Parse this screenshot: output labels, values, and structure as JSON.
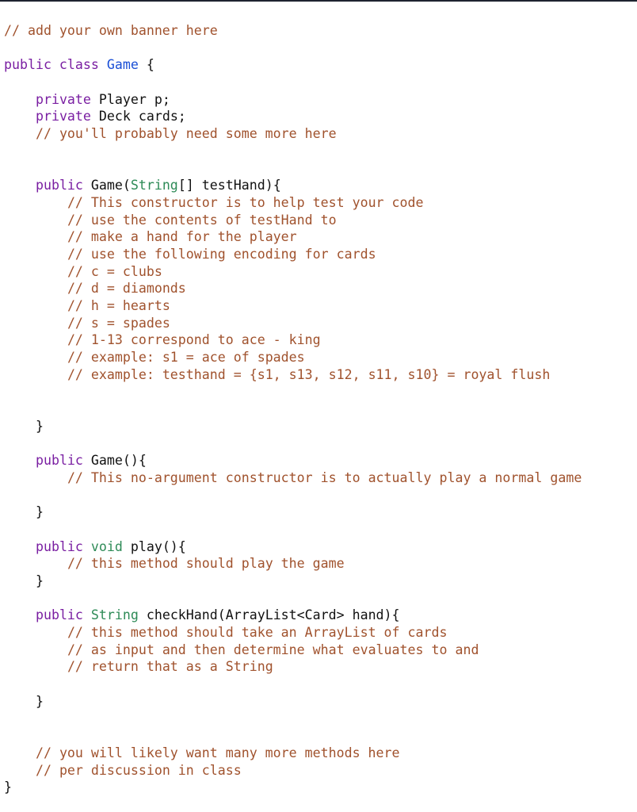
{
  "editor": {
    "lines": [
      [
        {
          "t": "cm",
          "v": "// add your own banner here"
        }
      ],
      [],
      [
        {
          "t": "kw",
          "v": "public class "
        },
        {
          "t": "cls",
          "v": "Game"
        },
        {
          "t": "pl",
          "v": " {"
        }
      ],
      [],
      [
        {
          "t": "pl",
          "v": "    "
        },
        {
          "t": "kw",
          "v": "private "
        },
        {
          "t": "pl",
          "v": "Player p;"
        }
      ],
      [
        {
          "t": "pl",
          "v": "    "
        },
        {
          "t": "kw",
          "v": "private "
        },
        {
          "t": "pl",
          "v": "Deck cards;"
        }
      ],
      [
        {
          "t": "pl",
          "v": "    "
        },
        {
          "t": "cm",
          "v": "// you'll probably need some more here"
        }
      ],
      [],
      [],
      [
        {
          "t": "pl",
          "v": "    "
        },
        {
          "t": "kw",
          "v": "public "
        },
        {
          "t": "pl",
          "v": "Game("
        },
        {
          "t": "ty",
          "v": "String"
        },
        {
          "t": "pl",
          "v": "[] testHand){"
        }
      ],
      [
        {
          "t": "pl",
          "v": "        "
        },
        {
          "t": "cm",
          "v": "// This constructor is to help test your code"
        }
      ],
      [
        {
          "t": "pl",
          "v": "        "
        },
        {
          "t": "cm",
          "v": "// use the contents of testHand to"
        }
      ],
      [
        {
          "t": "pl",
          "v": "        "
        },
        {
          "t": "cm",
          "v": "// make a hand for the player"
        }
      ],
      [
        {
          "t": "pl",
          "v": "        "
        },
        {
          "t": "cm",
          "v": "// use the following encoding for cards"
        }
      ],
      [
        {
          "t": "pl",
          "v": "        "
        },
        {
          "t": "cm",
          "v": "// c = clubs"
        }
      ],
      [
        {
          "t": "pl",
          "v": "        "
        },
        {
          "t": "cm",
          "v": "// d = diamonds"
        }
      ],
      [
        {
          "t": "pl",
          "v": "        "
        },
        {
          "t": "cm",
          "v": "// h = hearts"
        }
      ],
      [
        {
          "t": "pl",
          "v": "        "
        },
        {
          "t": "cm",
          "v": "// s = spades"
        }
      ],
      [
        {
          "t": "pl",
          "v": "        "
        },
        {
          "t": "cm",
          "v": "// 1-13 correspond to ace - king"
        }
      ],
      [
        {
          "t": "pl",
          "v": "        "
        },
        {
          "t": "cm",
          "v": "// example: s1 = ace of spades"
        }
      ],
      [
        {
          "t": "pl",
          "v": "        "
        },
        {
          "t": "cm",
          "v": "// example: testhand = {s1, s13, s12, s11, s10} = royal flush"
        }
      ],
      [],
      [],
      [
        {
          "t": "pl",
          "v": "    }"
        }
      ],
      [],
      [
        {
          "t": "pl",
          "v": "    "
        },
        {
          "t": "kw",
          "v": "public "
        },
        {
          "t": "pl",
          "v": "Game(){"
        }
      ],
      [
        {
          "t": "pl",
          "v": "        "
        },
        {
          "t": "cm",
          "v": "// This no-argument constructor is to actually play a normal game"
        }
      ],
      [],
      [
        {
          "t": "pl",
          "v": "    }"
        }
      ],
      [],
      [
        {
          "t": "pl",
          "v": "    "
        },
        {
          "t": "kw",
          "v": "public "
        },
        {
          "t": "ty",
          "v": "void "
        },
        {
          "t": "pl",
          "v": "play(){"
        }
      ],
      [
        {
          "t": "pl",
          "v": "        "
        },
        {
          "t": "cm",
          "v": "// this method should play the game"
        }
      ],
      [
        {
          "t": "pl",
          "v": "    }"
        }
      ],
      [],
      [
        {
          "t": "pl",
          "v": "    "
        },
        {
          "t": "kw",
          "v": "public "
        },
        {
          "t": "ty",
          "v": "String "
        },
        {
          "t": "pl",
          "v": "checkHand(ArrayList<Card> hand){"
        }
      ],
      [
        {
          "t": "pl",
          "v": "        "
        },
        {
          "t": "cm",
          "v": "// this method should take an ArrayList of cards"
        }
      ],
      [
        {
          "t": "pl",
          "v": "        "
        },
        {
          "t": "cm",
          "v": "// as input and then determine what evaluates to and"
        }
      ],
      [
        {
          "t": "pl",
          "v": "        "
        },
        {
          "t": "cm",
          "v": "// return that as a String"
        }
      ],
      [],
      [
        {
          "t": "pl",
          "v": "    }"
        }
      ],
      [],
      [],
      [
        {
          "t": "pl",
          "v": "    "
        },
        {
          "t": "cm",
          "v": "// you will likely want many more methods here"
        }
      ],
      [
        {
          "t": "pl",
          "v": "    "
        },
        {
          "t": "cm",
          "v": "// per discussion in class"
        }
      ],
      [
        {
          "t": "pl",
          "v": "}"
        }
      ]
    ]
  }
}
